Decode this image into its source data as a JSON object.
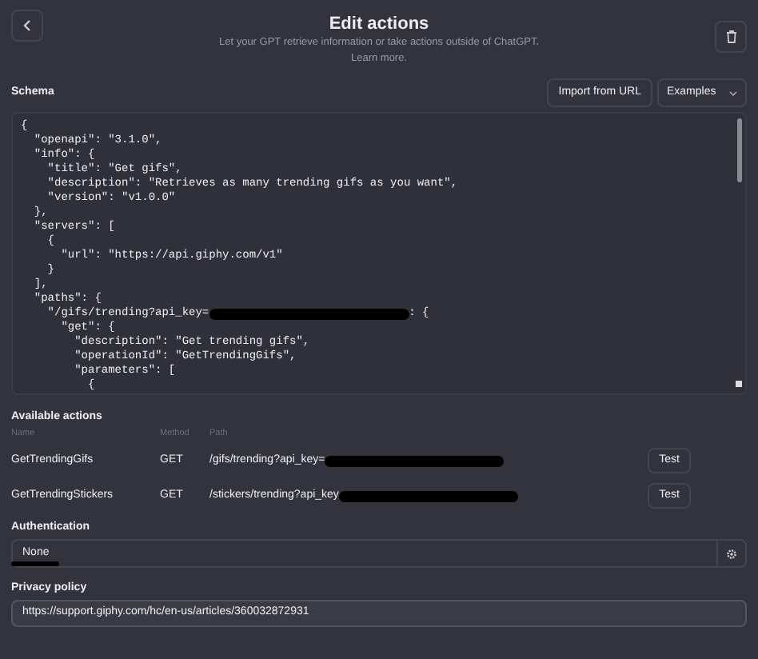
{
  "header": {
    "title": "Edit actions",
    "subtitle": "Let your GPT retrieve information or take actions outside of ChatGPT.",
    "link": "Learn more."
  },
  "schema": {
    "label": "Schema",
    "import_button": "Import from URL",
    "examples": "Examples",
    "lines": [
      {
        "text": "{"
      },
      {
        "text": "  \"openapi\": \"3.1.0\","
      },
      {
        "text": "  \"info\": {"
      },
      {
        "text": "    \"title\": \"Get gifs\","
      },
      {
        "text": "    \"description\": \"Retrieves as many trending gifs as you want\","
      },
      {
        "text": "    \"version\": \"v1.0.0\""
      },
      {
        "text": "  },"
      },
      {
        "text": "  \"servers\": ["
      },
      {
        "text": "    {"
      },
      {
        "text": "      \"url\": \"https://api.giphy.com/v1\""
      },
      {
        "text": "    }"
      },
      {
        "text": "  ],"
      },
      {
        "text": "  \"paths\": {"
      },
      {
        "text": "    \"/gifs/trending?api_key=",
        "redacted": true,
        "tail": ": {"
      },
      {
        "text": "      \"get\": {"
      },
      {
        "text": "        \"description\": \"Get trending gifs\","
      },
      {
        "text": "        \"operationId\": \"GetTrendingGifs\","
      },
      {
        "text": "        \"parameters\": ["
      },
      {
        "text": "          {"
      }
    ]
  },
  "actions": {
    "label": "Available actions",
    "columns": [
      "Name",
      "Method",
      "Path"
    ],
    "rows": [
      {
        "name": "GetTrendingGifs",
        "method": "GET",
        "path": "/gifs/trending?api_key=",
        "redacted": true,
        "button": "Test"
      },
      {
        "name": "GetTrendingStickers",
        "method": "GET",
        "path": "/stickers/trending?api_key",
        "redacted": true,
        "button": "Test"
      }
    ]
  },
  "authentication": {
    "label": "Authentication",
    "value": "None",
    "redacted": true
  },
  "privacy": {
    "label": "Privacy policy",
    "value": "https://support.giphy.com/hc/en-us/articles/360032872931"
  }
}
